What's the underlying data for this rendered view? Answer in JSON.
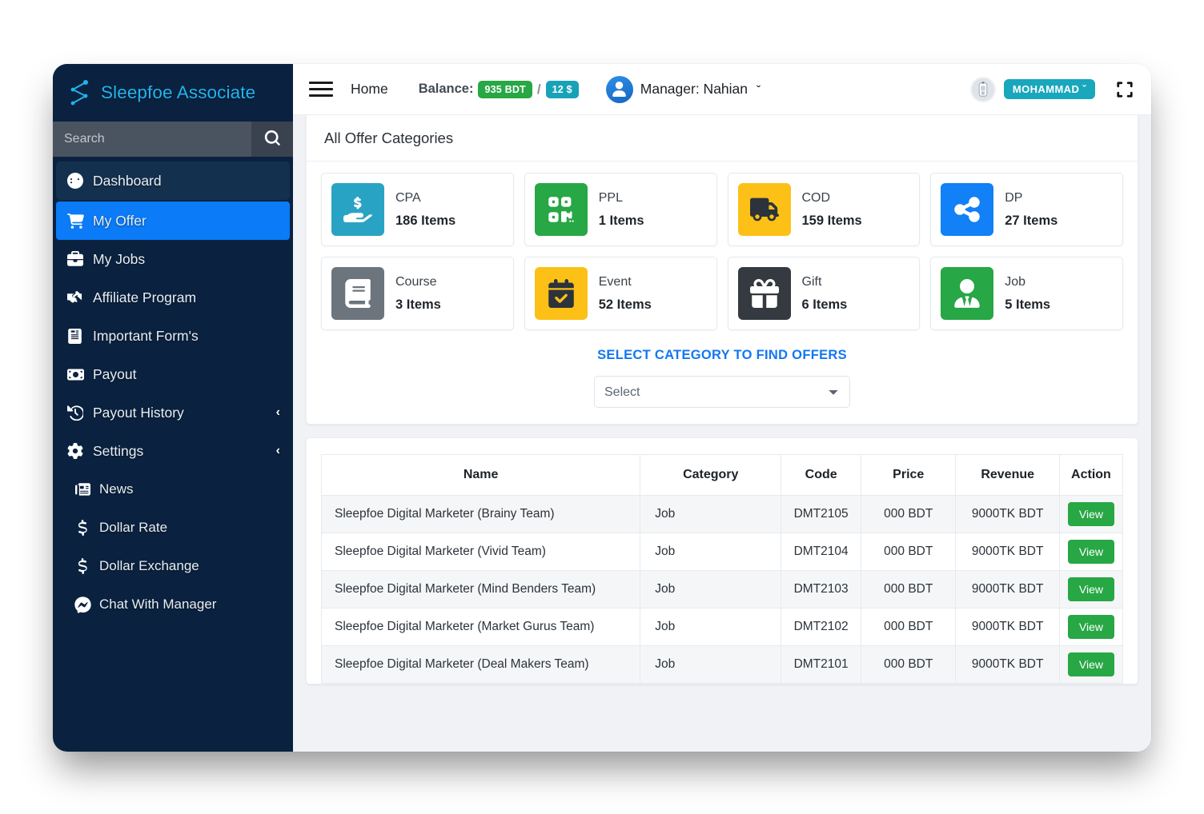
{
  "brand": {
    "name": "Sleepfoe Associate"
  },
  "search": {
    "placeholder": "Search",
    "value": ""
  },
  "sidebar": {
    "items": [
      {
        "label": "Dashboard",
        "icon": "gauge-icon",
        "state": "hover"
      },
      {
        "label": "My Offer",
        "icon": "cart-icon",
        "state": "active"
      },
      {
        "label": "My Jobs",
        "icon": "briefcase-icon",
        "state": "normal"
      },
      {
        "label": "Affiliate Program",
        "icon": "handshake-icon",
        "state": "normal"
      },
      {
        "label": "Important Form's",
        "icon": "form-icon",
        "state": "normal"
      },
      {
        "label": "Payout",
        "icon": "money-check-icon",
        "state": "normal"
      },
      {
        "label": "Payout History",
        "icon": "history-icon",
        "state": "normal",
        "chevron": "‹"
      },
      {
        "label": "Settings",
        "icon": "gear-icon",
        "state": "normal",
        "chevron": "‹"
      },
      {
        "label": "News",
        "icon": "newspaper-icon",
        "state": "sub"
      },
      {
        "label": "Dollar Rate",
        "icon": "dollar-icon",
        "state": "sub"
      },
      {
        "label": "Dollar Exchange",
        "icon": "dollar-icon",
        "state": "sub"
      },
      {
        "label": "Chat With Manager",
        "icon": "messenger-icon",
        "state": "sub"
      }
    ]
  },
  "topbar": {
    "home_label": "Home",
    "balance_label": "Balance:",
    "balance_bdt": "935 BDT",
    "balance_separator": "/",
    "balance_usd": "12 $",
    "manager_label": "Manager: Nahian",
    "manager_chevron": "ˇ",
    "user_name": "MOHAMMAD",
    "user_chevron": "ˇ",
    "hamburger_icon": "hamburger-icon",
    "fullscreen_icon": "expand-arrows-icon"
  },
  "categories_panel": {
    "title": "All Offer Categories",
    "items": [
      {
        "name": "CPA",
        "count": "186 Items",
        "color": "#29a3c4",
        "icon": "hand-holding-dollar-icon"
      },
      {
        "name": "PPL",
        "count": "1 Items",
        "color": "#27a745",
        "icon": "qrcode-icon"
      },
      {
        "name": "COD",
        "count": "159 Items",
        "color": "#fcc017",
        "icon": "truck-icon"
      },
      {
        "name": "DP",
        "count": "27 Items",
        "color": "#1280f6",
        "icon": "share-nodes-icon"
      },
      {
        "name": "Course",
        "count": "3 Items",
        "color": "#6c757d",
        "icon": "book-icon"
      },
      {
        "name": "Event",
        "count": "52 Items",
        "color": "#fcc017",
        "icon": "calendar-check-icon"
      },
      {
        "name": "Gift",
        "count": "6 Items",
        "color": "#343a40",
        "icon": "gift-icon"
      },
      {
        "name": "Job",
        "count": "5 Items",
        "color": "#27a745",
        "icon": "user-tie-icon"
      }
    ],
    "select_heading": "SELECT CATEGORY TO FIND OFFERS",
    "select_value": "Select",
    "select_options": [
      "Select"
    ]
  },
  "offers_table": {
    "columns": [
      "Name",
      "Category",
      "Code",
      "Price",
      "Revenue",
      "Action"
    ],
    "action_label": "View",
    "rows": [
      {
        "name": "Sleepfoe Digital Marketer (Brainy Team)",
        "category": "Job",
        "code": "DMT2105",
        "price": "000 BDT",
        "revenue": "9000TK BDT"
      },
      {
        "name": "Sleepfoe Digital Marketer (Vivid Team)",
        "category": "Job",
        "code": "DMT2104",
        "price": "000 BDT",
        "revenue": "9000TK BDT"
      },
      {
        "name": "Sleepfoe Digital Marketer (Mind Benders Team)",
        "category": "Job",
        "code": "DMT2103",
        "price": "000 BDT",
        "revenue": "9000TK BDT"
      },
      {
        "name": "Sleepfoe Digital Marketer (Market Gurus Team)",
        "category": "Job",
        "code": "DMT2102",
        "price": "000 BDT",
        "revenue": "9000TK BDT"
      },
      {
        "name": "Sleepfoe Digital Marketer (Deal Makers Team)",
        "category": "Job",
        "code": "DMT2101",
        "price": "000 BDT",
        "revenue": "9000TK BDT"
      }
    ]
  },
  "colors": {
    "sidebar_bg": "#0a2240",
    "accent_blue": "#0b7bf7",
    "brand_cyan": "#23b3ec",
    "success_green": "#28a745",
    "info_teal": "#17a2b8",
    "page_bg": "#f0f2f5"
  }
}
